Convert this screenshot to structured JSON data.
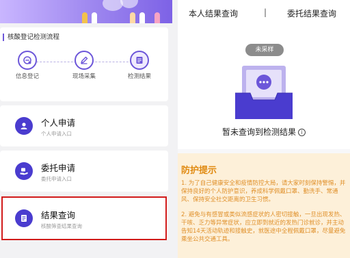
{
  "left": {
    "process": {
      "title": "核酸登记检测流程",
      "steps": [
        {
          "label": "信息登记",
          "icon": "info-register-icon"
        },
        {
          "label": "现场采集",
          "icon": "pen-collect-icon"
        },
        {
          "label": "检测结果",
          "icon": "result-doc-icon"
        }
      ]
    },
    "menu": [
      {
        "title": "个人申请",
        "sub": "个人申请入口",
        "icon": "person-icon"
      },
      {
        "title": "委托申请",
        "sub": "委托申请入口",
        "icon": "delegate-hand-icon"
      },
      {
        "title": "结果查询",
        "sub": "核酸筛查结果查询",
        "icon": "result-query-icon"
      }
    ],
    "highlighted_item": "结果查询"
  },
  "right": {
    "tabs": [
      "本人结果查询",
      "委托结果查询"
    ],
    "tab_separator": "|",
    "badge": "未采样",
    "empty_text": "暂未查询到检测结果",
    "tips": {
      "title": "防护提示",
      "paragraphs": [
        "1. 为了自己健康安全和疫情防控大局，请大家时刻保持警惕，并保持良好的个人防护意识，养成科学佩戴口罩、勤洗手、常通风、保持安全社交距离的卫生习惯。",
        "2. 避免与有感冒或类似流感症状的人密切接触，一旦出现发热、干咳、乏力等异常症状，应立即到就近的发热门诊就诊，并主动告知14天活动轨迹和接触史，就医途中全程佩戴口罩，尽量避免乘坐公共交通工具。"
      ]
    }
  },
  "colors": {
    "accent": "#4a3ccf",
    "highlight_border": "#d11a1a",
    "tips_bg": "#fdf0d9",
    "tips_text": "#e08a11"
  }
}
